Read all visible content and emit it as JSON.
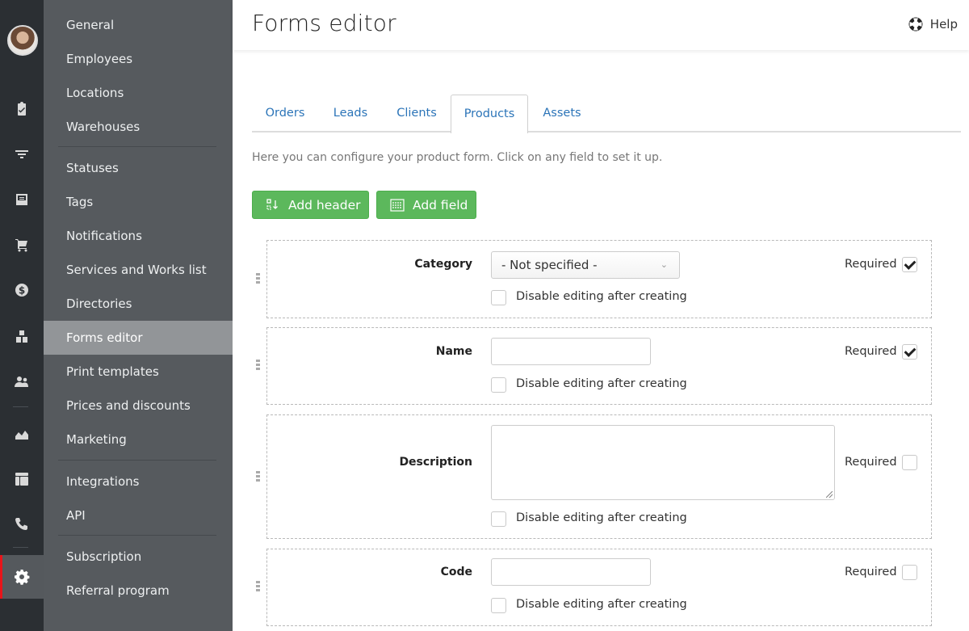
{
  "rail": {
    "avatar_alt": "User avatar",
    "icons": [
      "clipboard-check-icon",
      "funnel-icon",
      "inbox-icon",
      "cart-icon",
      "dollar-icon",
      "boxes-icon",
      "users-icon",
      "chart-area-icon",
      "table-icon",
      "phone-icon",
      "gear-icon"
    ],
    "active": "gear-icon",
    "active_color": "#e8141a"
  },
  "nav": {
    "items": [
      {
        "label": "General"
      },
      {
        "label": "Employees"
      },
      {
        "label": "Locations"
      },
      {
        "label": "Warehouses"
      },
      {
        "label": "Statuses"
      },
      {
        "label": "Tags"
      },
      {
        "label": "Notifications"
      },
      {
        "label": "Services and Works list"
      },
      {
        "label": "Directories"
      },
      {
        "label": "Forms editor"
      },
      {
        "label": "Print templates"
      },
      {
        "label": "Prices and discounts"
      },
      {
        "label": "Marketing"
      },
      {
        "label": "Integrations"
      },
      {
        "label": "API"
      },
      {
        "label": "Subscription"
      },
      {
        "label": "Referral program"
      }
    ],
    "active": "Forms editor"
  },
  "header": {
    "title": "Forms editor",
    "help_label": "Help"
  },
  "tabs": {
    "items": [
      {
        "label": "Orders"
      },
      {
        "label": "Leads"
      },
      {
        "label": "Clients"
      },
      {
        "label": "Products"
      },
      {
        "label": "Assets"
      }
    ],
    "active": "Products"
  },
  "description": "Here you can configure your product form. Click on any field to set it up.",
  "buttons": {
    "add_header": "Add header",
    "add_field": "Add field",
    "color": "#5cb85c"
  },
  "fields": [
    {
      "label": "Category",
      "type": "select",
      "value": "- Not specified -",
      "required": true,
      "disable_editing": false
    },
    {
      "label": "Name",
      "type": "text",
      "value": "",
      "required": true,
      "disable_editing": false
    },
    {
      "label": "Description",
      "type": "textarea",
      "value": "",
      "required": false,
      "disable_editing": false
    },
    {
      "label": "Code",
      "type": "text",
      "value": "",
      "required": false,
      "disable_editing": false
    }
  ],
  "common": {
    "required_label": "Required",
    "disable_label": "Disable editing after creating"
  }
}
